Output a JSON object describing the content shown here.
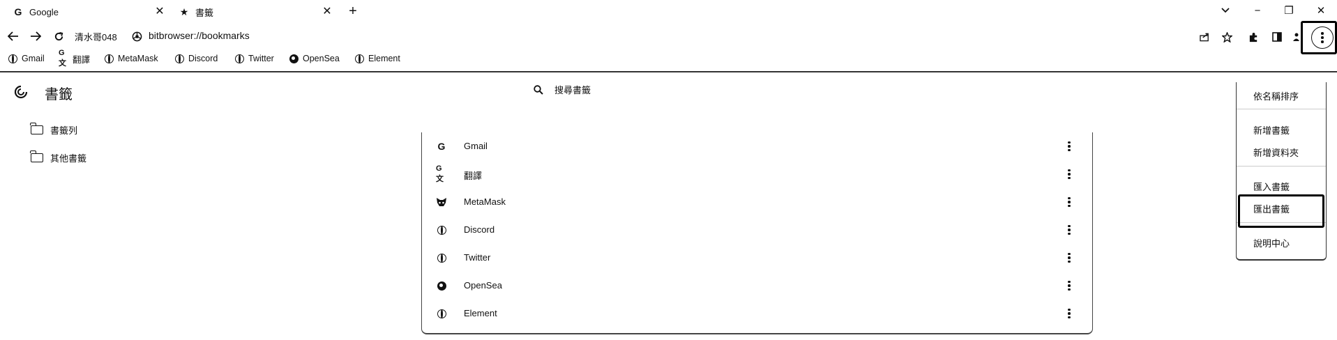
{
  "tabs": [
    {
      "title": "Google",
      "icon": "google-icon"
    },
    {
      "title": "書籤",
      "icon": "star-icon"
    }
  ],
  "new_tab_symbol": "+",
  "window_controls": {
    "dropdown": "⌄",
    "minimize": "−",
    "restore": "❐",
    "close": "✕"
  },
  "toolbar": {
    "profile_name": "清水哥048",
    "url": "bitbrowser://bookmarks"
  },
  "bookmarks_bar": [
    {
      "label": "Gmail",
      "icon": "globe-icon"
    },
    {
      "label": "翻譯",
      "icon": "translate-icon"
    },
    {
      "label": "MetaMask",
      "icon": "globe-icon"
    },
    {
      "label": "Discord",
      "icon": "globe-icon"
    },
    {
      "label": "Twitter",
      "icon": "globe-icon"
    },
    {
      "label": "OpenSea",
      "icon": "opensea-icon"
    },
    {
      "label": "Element",
      "icon": "globe-icon"
    }
  ],
  "page": {
    "title": "書籤",
    "search_placeholder": "搜尋書籤"
  },
  "folders": [
    {
      "label": "書籤列"
    },
    {
      "label": "其他書籤"
    }
  ],
  "bookmarks": [
    {
      "label": "Gmail",
      "icon": "google-icon"
    },
    {
      "label": "翻譯",
      "icon": "translate-icon"
    },
    {
      "label": "MetaMask",
      "icon": "metamask-icon"
    },
    {
      "label": "Discord",
      "icon": "globe-icon"
    },
    {
      "label": "Twitter",
      "icon": "globe-icon"
    },
    {
      "label": "OpenSea",
      "icon": "opensea-icon"
    },
    {
      "label": "Element",
      "icon": "globe-icon"
    }
  ],
  "menu": {
    "sort": "依名稱排序",
    "add_bookmark": "新增書籤",
    "add_folder": "新增資料夾",
    "import": "匯入書籤",
    "export": "匯出書籤",
    "help": "說明中心"
  }
}
